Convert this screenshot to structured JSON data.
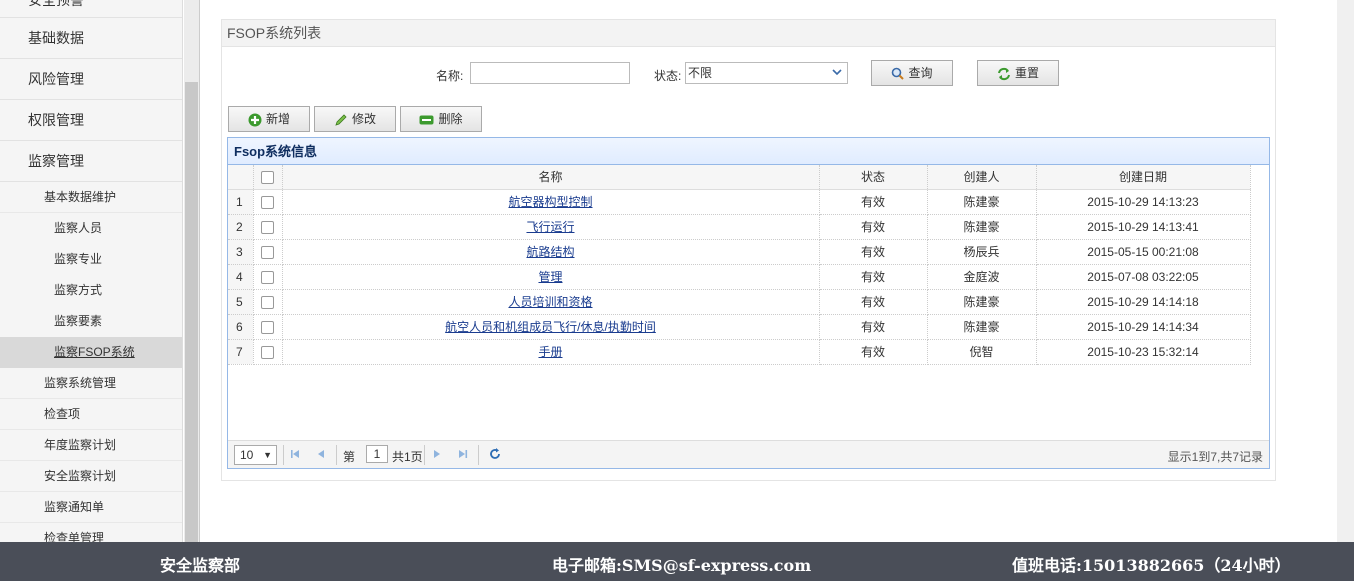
{
  "sidebar": {
    "top_items": [
      "安全预警",
      "基础数据",
      "风险管理",
      "权限管理",
      "监察管理"
    ],
    "sub_items": [
      {
        "label": "基本数据维护",
        "level": 2
      },
      {
        "label": "监察人员",
        "level": 3
      },
      {
        "label": "监察专业",
        "level": 3
      },
      {
        "label": "监察方式",
        "level": 3
      },
      {
        "label": "监察要素",
        "level": 3
      },
      {
        "label": "监察FSOP系统",
        "level": 3,
        "active": true
      },
      {
        "label": "监察系统管理",
        "level": 2
      },
      {
        "label": "检查项",
        "level": 2
      },
      {
        "label": "年度监察计划",
        "level": 2
      },
      {
        "label": "安全监察计划",
        "level": 2
      },
      {
        "label": "监察通知单",
        "level": 2
      },
      {
        "label": "检查单管理",
        "level": 2
      }
    ]
  },
  "panel": {
    "title": "FSOP系统列表"
  },
  "search": {
    "name_label": "名称:",
    "name_value": "",
    "status_label": "状态:",
    "status_value": "不限",
    "query_label": "查询",
    "reset_label": "重置"
  },
  "toolbar": {
    "add": "新增",
    "edit": "修改",
    "delete": "删除"
  },
  "grid": {
    "title": "Fsop系统信息",
    "columns": [
      "名称",
      "状态",
      "创建人",
      "创建日期"
    ],
    "rows": [
      {
        "no": "1",
        "name": "航空器构型控制",
        "status": "有效",
        "creator": "陈建豪",
        "date": "2015-10-29 14:13:23"
      },
      {
        "no": "2",
        "name": "飞行运行",
        "status": "有效",
        "creator": "陈建豪",
        "date": "2015-10-29 14:13:41"
      },
      {
        "no": "3",
        "name": "航路结构",
        "status": "有效",
        "creator": "杨辰兵",
        "date": "2015-05-15 00:21:08"
      },
      {
        "no": "4",
        "name": "管理",
        "status": "有效",
        "creator": "金庭波",
        "date": "2015-07-08 03:22:05"
      },
      {
        "no": "5",
        "name": "人员培训和资格",
        "status": "有效",
        "creator": "陈建豪",
        "date": "2015-10-29 14:14:18"
      },
      {
        "no": "6",
        "name": "航空人员和机组成员飞行/休息/执勤时间",
        "status": "有效",
        "creator": "陈建豪",
        "date": "2015-10-29 14:14:34"
      },
      {
        "no": "7",
        "name": "手册",
        "status": "有效",
        "creator": "倪智",
        "date": "2015-10-23 15:32:14"
      }
    ]
  },
  "pager": {
    "page_size": "10",
    "page_prefix": "第",
    "page_num": "1",
    "page_suffix": "共1页",
    "info": "显示1到7,共7记录"
  },
  "footer": {
    "dept": "安全监察部",
    "email": "电子邮箱:SMS@sf-express.com",
    "phone": "值班电话:15013882665（24小时）"
  }
}
